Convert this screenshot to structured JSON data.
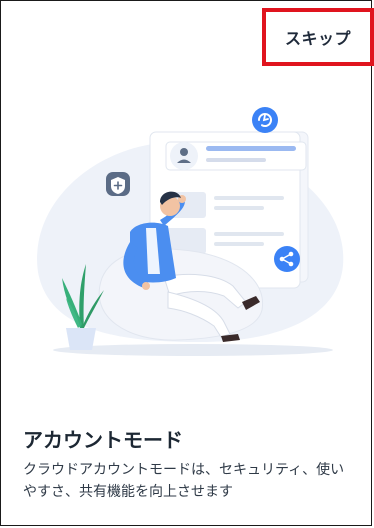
{
  "header": {
    "skip_label": "スキップ"
  },
  "onboarding": {
    "title": "アカウントモード",
    "description": "クラウドアカウントモードは、セキュリティ、使いやすさ、共有機能を向上させます"
  },
  "icons": {
    "sync": "sync-icon",
    "user": "user-icon",
    "shield": "shield-plus-icon",
    "share": "share-icon"
  },
  "colors": {
    "accent": "#3b82f6",
    "highlight_border": "#e0141e",
    "text_primary": "#1c2733"
  }
}
